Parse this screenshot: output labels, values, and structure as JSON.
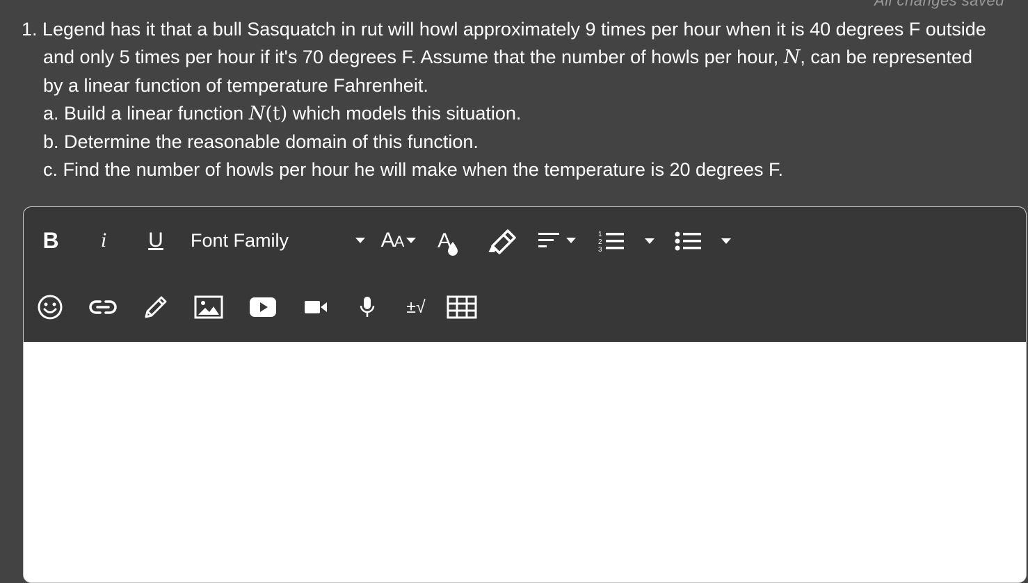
{
  "status": {
    "text": "All changes saved"
  },
  "question": {
    "line1": "1. Legend has it that a bull Sasquatch in rut will howl approximately 9 times per hour when it is 40 degrees F outside",
    "line2_pre": "and only 5 times per hour if it's 70 degrees F. Assume that the number of howls per hour, ",
    "line2_var": "N",
    "line2_post": ", can be represented",
    "line3": "by a linear function of temperature Fahrenheit.",
    "part_a_pre": "a. Build a linear function ",
    "part_a_func": "N",
    "part_a_arg": "(t)",
    "part_a_post": " which models this situation.",
    "part_b": "b. Determine the reasonable domain of this function.",
    "part_c": "c. Find the number of howls per hour he will make when the temperature is 20 degrees F."
  },
  "toolbar": {
    "bold_label": "B",
    "italic_label": "i",
    "underline_label": "U",
    "font_family_label": "Font Family",
    "font_size_label": "AA",
    "math_label": "±√",
    "icons": [
      "bold-icon",
      "italic-icon",
      "underline-icon",
      "font-size-icon",
      "text-color-icon",
      "highlighter-icon",
      "align-icon",
      "numbered-list-icon",
      "bullet-list-icon",
      "emoji-icon",
      "link-icon",
      "pencil-icon",
      "image-icon",
      "youtube-icon",
      "video-icon",
      "microphone-icon",
      "math-icon",
      "table-icon"
    ]
  },
  "editor": {
    "content": ""
  },
  "colors": {
    "page_bg": "#434343",
    "toolbar_bg": "#373737",
    "text": "#ffffff",
    "editor_bg": "#ffffff"
  }
}
